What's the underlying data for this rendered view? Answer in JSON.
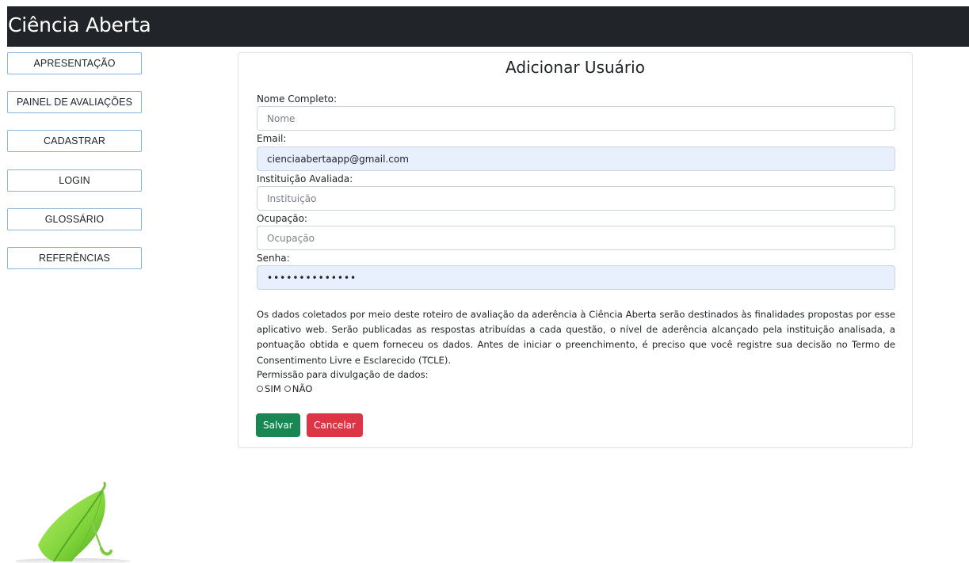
{
  "header": {
    "brand": "Ciência Aberta"
  },
  "nav": {
    "items": [
      {
        "label": "APRESENTAÇÃO"
      },
      {
        "label": "PAINEL DE AVALIAÇÕES"
      },
      {
        "label": "CADASTRAR"
      },
      {
        "label": "LOGIN"
      },
      {
        "label": "GLOSSÁRIO"
      },
      {
        "label": "REFERÊNCIAS"
      }
    ]
  },
  "form": {
    "title": "Adicionar Usuário",
    "name": {
      "label": "Nome Completo:",
      "placeholder": "Nome",
      "value": ""
    },
    "email": {
      "label": "Email:",
      "value": "cienciaabertaapp@gmail.com"
    },
    "institution": {
      "label": "Instituição Avaliada:",
      "placeholder": "Instituição",
      "value": ""
    },
    "occupation": {
      "label": "Ocupação:",
      "placeholder": "Ocupação",
      "value": ""
    },
    "password": {
      "label": "Senha:",
      "value": "••••••••••••••"
    },
    "consent_text": "Os dados coletados por meio deste roteiro de avaliação da aderência à Ciência Aberta serão destinados às finalidades propostas por esse aplicativo web. Serão publicadas as respostas atribuídas a cada questão, o nível de aderência alcançado pela instituição analisada, a pontuação obtida e quem forneceu os dados. Antes de iniciar o preenchimento, é preciso que você registre sua decisão no Termo de Consentimento Livre e Esclarecido (TCLE).",
    "permission_label": "Permissão para divulgação de dados:",
    "option_yes": "SIM",
    "option_no": "NÃO",
    "save_label": "Salvar",
    "cancel_label": "Cancelar"
  },
  "colors": {
    "header_bg": "#212529",
    "save": "#198754",
    "cancel": "#dc3545",
    "autofill": "#e8f0fe"
  },
  "icons": {
    "logo": "umbrella-icon"
  }
}
